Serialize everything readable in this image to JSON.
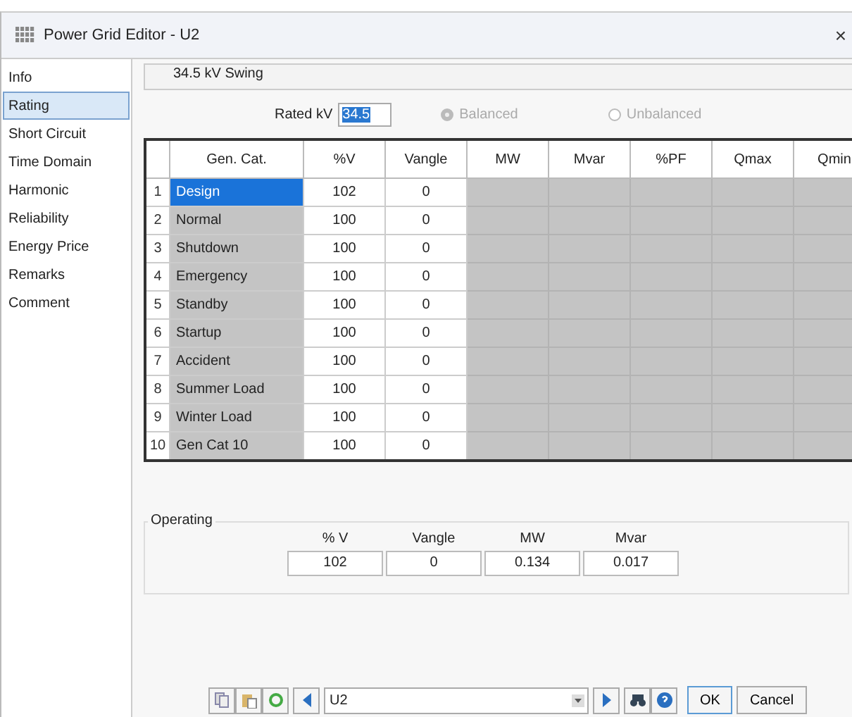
{
  "window": {
    "title": "Power Grid Editor - U2",
    "close": "×"
  },
  "sidebar": {
    "items": [
      {
        "label": "Info",
        "selected": false
      },
      {
        "label": "Rating",
        "selected": true
      },
      {
        "label": "Short Circuit",
        "selected": false
      },
      {
        "label": "Time Domain",
        "selected": false
      },
      {
        "label": "Harmonic",
        "selected": false
      },
      {
        "label": "Reliability",
        "selected": false
      },
      {
        "label": "Energy Price",
        "selected": false
      },
      {
        "label": "Remarks",
        "selected": false
      },
      {
        "label": "Comment",
        "selected": false
      }
    ]
  },
  "header": "34.5 kV  Swing",
  "rated_kv": {
    "label": "Rated kV",
    "value": "34.5"
  },
  "radios": [
    {
      "label": "Balanced",
      "selected": true,
      "disabled": true
    },
    {
      "label": "Unbalanced",
      "selected": false,
      "disabled": true
    }
  ],
  "table": {
    "columns": [
      "Gen. Cat.",
      "%V",
      "Vangle",
      "MW",
      "Mvar",
      "%PF",
      "Qmax",
      "Qmin"
    ],
    "rows": [
      {
        "num": "1",
        "cat": "Design",
        "v": "102",
        "vangle": "0",
        "selected": true
      },
      {
        "num": "2",
        "cat": "Normal",
        "v": "100",
        "vangle": "0",
        "selected": false
      },
      {
        "num": "3",
        "cat": "Shutdown",
        "v": "100",
        "vangle": "0",
        "selected": false
      },
      {
        "num": "4",
        "cat": "Emergency",
        "v": "100",
        "vangle": "0",
        "selected": false
      },
      {
        "num": "5",
        "cat": "Standby",
        "v": "100",
        "vangle": "0",
        "selected": false
      },
      {
        "num": "6",
        "cat": "Startup",
        "v": "100",
        "vangle": "0",
        "selected": false
      },
      {
        "num": "7",
        "cat": "Accident",
        "v": "100",
        "vangle": "0",
        "selected": false
      },
      {
        "num": "8",
        "cat": "Summer Load",
        "v": "100",
        "vangle": "0",
        "selected": false
      },
      {
        "num": "9",
        "cat": "Winter Load",
        "v": "100",
        "vangle": "0",
        "selected": false
      },
      {
        "num": "10",
        "cat": "Gen Cat 10",
        "v": "100",
        "vangle": "0",
        "selected": false
      }
    ]
  },
  "operating": {
    "title": "Operating",
    "fields": [
      {
        "label": "% V",
        "value": "102"
      },
      {
        "label": "Vangle",
        "value": "0"
      },
      {
        "label": "MW",
        "value": "0.134"
      },
      {
        "label": "Mvar",
        "value": "0.017"
      }
    ]
  },
  "toolbar": {
    "selector": "U2",
    "ok": "OK",
    "cancel": "Cancel"
  }
}
